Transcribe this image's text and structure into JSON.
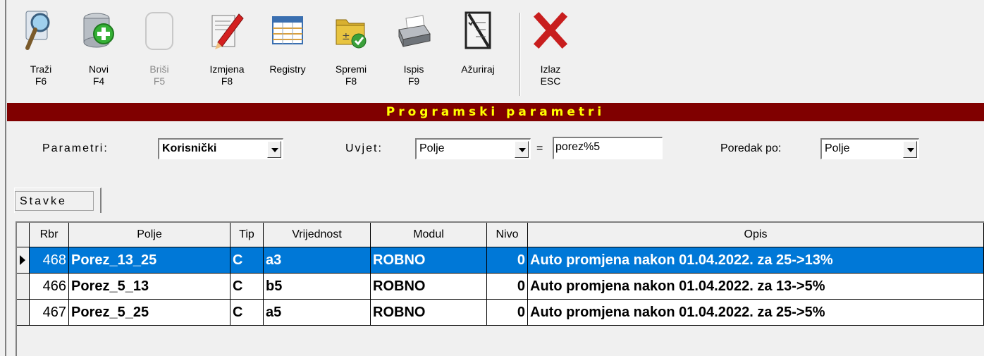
{
  "toolbar": {
    "buttons": [
      {
        "label": "Traži",
        "key": "F6",
        "icon": "search-icon"
      },
      {
        "label": "Novi",
        "key": "F4",
        "icon": "add-database-icon"
      },
      {
        "label": "Briši",
        "key": "F5",
        "icon": "delete-icon"
      },
      {
        "label": "Izmjena",
        "key": "F8",
        "icon": "edit-icon"
      },
      {
        "label": "Registry",
        "key": "",
        "icon": "registry-icon"
      },
      {
        "label": "Spremi",
        "key": "F8",
        "icon": "save-folder-icon"
      },
      {
        "label": "Ispis",
        "key": "F9",
        "icon": "printer-icon"
      },
      {
        "label": "Ažuriraj",
        "key": "",
        "icon": "update-checklist-icon"
      },
      {
        "label": "Izlaz",
        "key": "ESC",
        "icon": "close-icon"
      }
    ]
  },
  "title": "Programski parametri",
  "filters": {
    "parametri_label": "Parametri:",
    "parametri_value": "Korisnički",
    "uvjet_label": "Uvjet:",
    "uvjet_field": "Polje",
    "equals": "=",
    "uvjet_value": "porez%5",
    "poredak_label": "Poredak po:",
    "poredak_value": "Polje"
  },
  "tab": "Stavke",
  "grid": {
    "headers": [
      "Rbr",
      "Polje",
      "Tip",
      "Vrijednost",
      "Modul",
      "Nivo",
      "Opis"
    ],
    "rows": [
      {
        "rbr": "468",
        "polje": "Porez_13_25",
        "tip": "C",
        "vrijednost": "a3",
        "modul": "ROBNO",
        "nivo": "0",
        "opis": "Auto promjena nakon 01.04.2022. za 25->13%",
        "selected": true
      },
      {
        "rbr": "466",
        "polje": "Porez_5_13",
        "tip": "C",
        "vrijednost": "b5",
        "modul": "ROBNO",
        "nivo": "0",
        "opis": "Auto promjena nakon 01.04.2022. za 13->5%",
        "selected": false
      },
      {
        "rbr": "467",
        "polje": "Porez_5_25",
        "tip": "C",
        "vrijednost": "a5",
        "modul": "ROBNO",
        "nivo": "0",
        "opis": "Auto promjena nakon 01.04.2022. za 25->5%",
        "selected": false
      }
    ]
  },
  "colors": {
    "title_band": "#800000",
    "title_text": "#ffff00",
    "selection": "#0078d7"
  }
}
